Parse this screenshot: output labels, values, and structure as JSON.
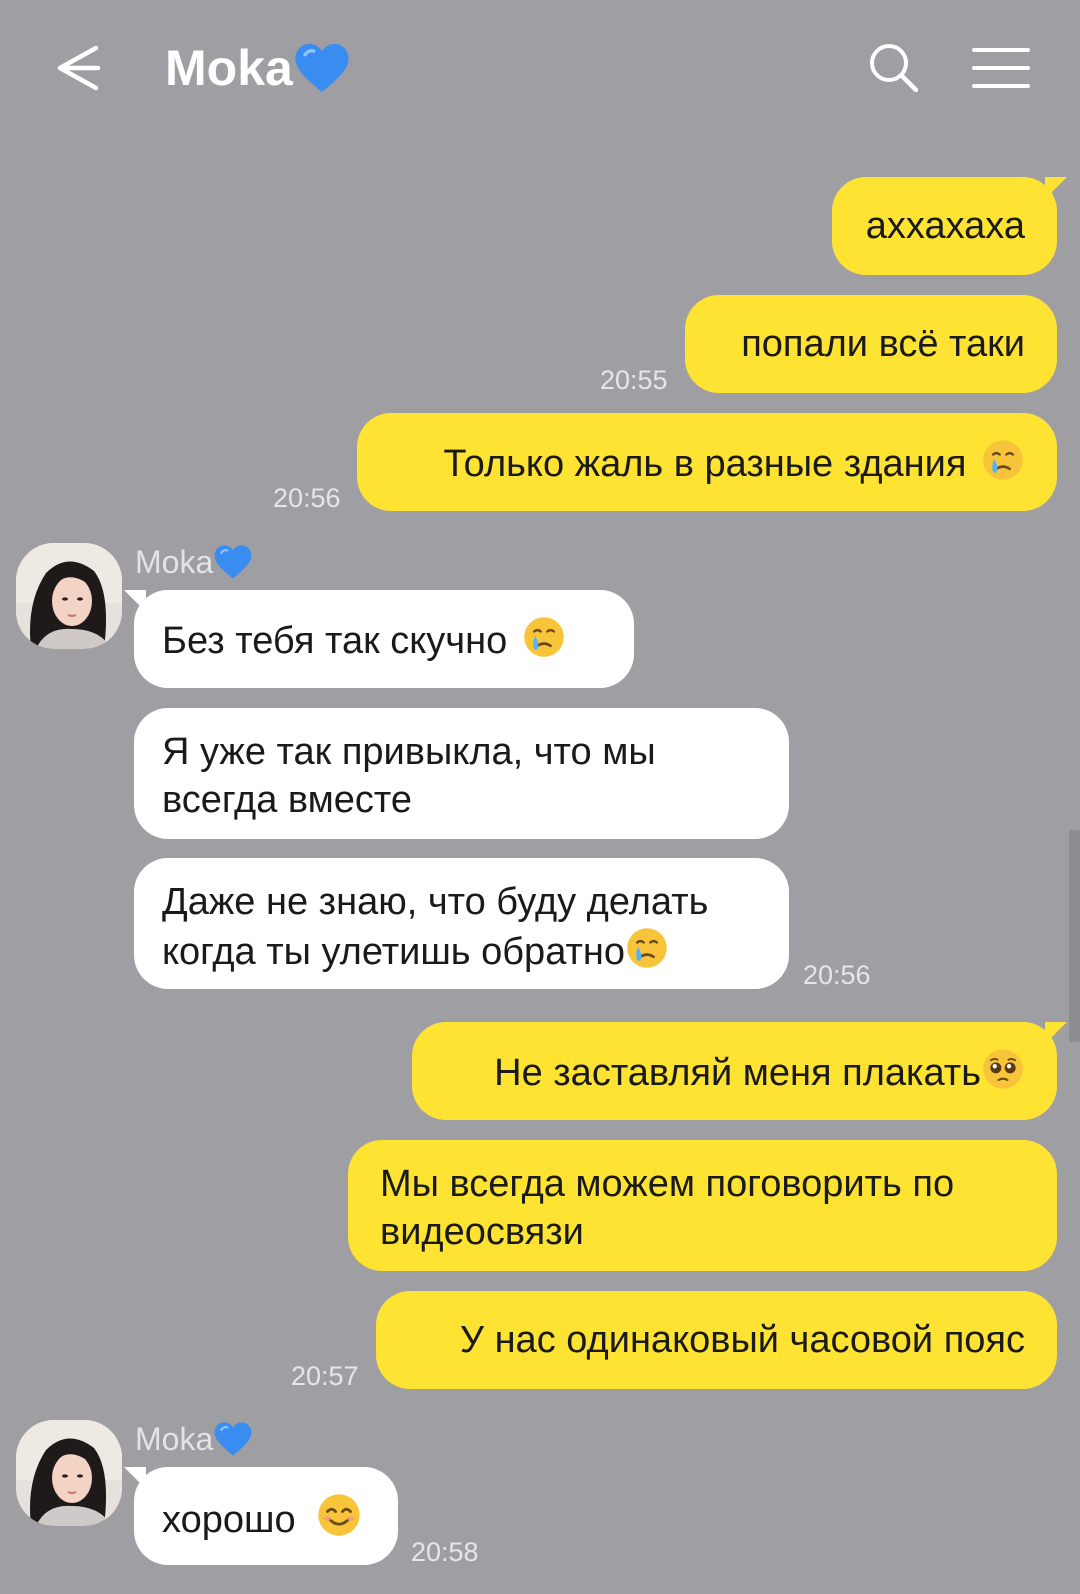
{
  "header": {
    "title": "Moka",
    "title_emoji": "blue-heart-icon",
    "back_icon": "arrow-left-icon",
    "search_icon": "search-icon",
    "menu_icon": "hamburger-menu-icon"
  },
  "messages": {
    "m1": {
      "text": "аххахаха"
    },
    "m2": {
      "text": "попали всё таки",
      "time": "20:55"
    },
    "m3": {
      "text": "Только жаль в разные здания",
      "emoji": "crying-face-icon",
      "time": "20:56"
    },
    "g1": {
      "sender": "Moka",
      "sender_emoji": "blue-heart-icon"
    },
    "m4": {
      "text": "Без тебя так скучно",
      "emoji": "crying-face-icon"
    },
    "m5": {
      "line1": "Я уже так привыкла, что мы",
      "line2": "всегда вместе"
    },
    "m6": {
      "line1": "Даже не знаю, что буду делать",
      "line2": "когда ты улетишь обратно",
      "emoji": "crying-face-icon",
      "time": "20:56"
    },
    "m7": {
      "text": "Не заставляй меня плакать",
      "emoji": "pleading-face-icon"
    },
    "m8": {
      "line1": "Мы всегда можем поговорить по",
      "line2": "видеосвязи"
    },
    "m9": {
      "text": "У нас одинаковый часовой пояс",
      "time": "20:57"
    },
    "g2": {
      "sender": "Moka",
      "sender_emoji": "blue-heart-icon"
    },
    "m10": {
      "text": "хорошо",
      "emoji": "smiling-face-icon",
      "time": "20:58"
    }
  },
  "colors": {
    "background": "#9f9ea3",
    "my_bubble": "#fee333",
    "their_bubble": "#ffffff",
    "heart": "#3a8df0"
  }
}
